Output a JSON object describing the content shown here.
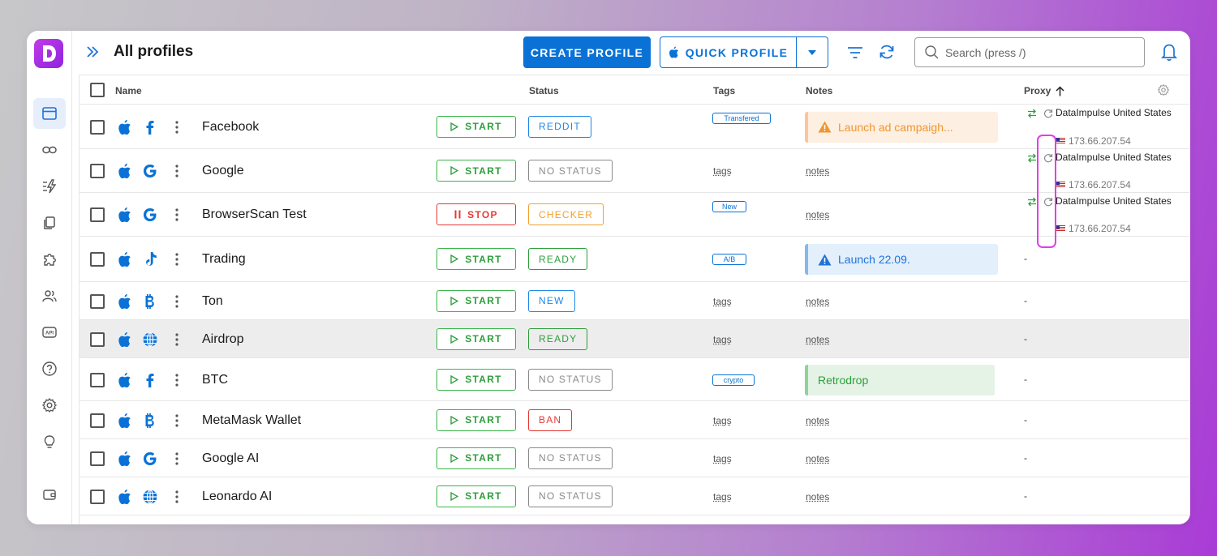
{
  "app": {
    "logo_letter": "D",
    "brand_color": "#a52de2",
    "accent": "#0a72d6"
  },
  "sidebar": {
    "items": [
      {
        "name": "profiles",
        "icon": "browser-window-icon",
        "active": true
      },
      {
        "name": "proxies",
        "icon": "link-icon"
      },
      {
        "name": "automation",
        "icon": "lightning-icon"
      },
      {
        "name": "copies",
        "icon": "copy-icon"
      },
      {
        "name": "extensions",
        "icon": "puzzle-icon"
      },
      {
        "name": "team",
        "icon": "users-icon"
      },
      {
        "name": "api",
        "icon": "api-icon",
        "label": "API"
      },
      {
        "name": "help",
        "icon": "help-icon"
      },
      {
        "name": "settings",
        "icon": "gear-icon"
      },
      {
        "name": "ideas",
        "icon": "lightbulb-icon"
      },
      {
        "name": "wallet",
        "icon": "wallet-icon"
      }
    ]
  },
  "header": {
    "title": "All profiles",
    "create_label": "CREATE PROFILE",
    "quick_label": "QUICK PROFILE",
    "search_placeholder": "Search (press /)"
  },
  "table": {
    "columns": {
      "name": "Name",
      "status": "Status",
      "tags": "Tags",
      "notes": "Notes",
      "proxy": "Proxy"
    },
    "rows": [
      {
        "name": "Facebook",
        "app": "facebook",
        "action": "START",
        "status": "REDDIT",
        "status_color": "#1e88e5",
        "tag": "Transfered",
        "note": "Launch ad campaigh...",
        "note_type": "warning",
        "proxy": {
          "name": "DataImpulse United States",
          "ip": "173.66.207.54"
        }
      },
      {
        "name": "Google",
        "app": "google",
        "action": "START",
        "status": "NO STATUS",
        "status_color": "#8a8a8a",
        "tag_placeholder": "tags",
        "note_placeholder": "notes",
        "proxy": {
          "name": "DataImpulse United States",
          "ip": "173.66.207.54"
        }
      },
      {
        "name": "BrowserScan Test",
        "app": "google",
        "action": "STOP",
        "status": "CHECKER",
        "status_color": "#f0a030",
        "tag": "New",
        "note_placeholder": "notes",
        "proxy": {
          "name": "DataImpulse United States",
          "ip": "173.66.207.54"
        }
      },
      {
        "name": "Trading",
        "app": "tiktok",
        "action": "START",
        "status": "READY",
        "status_color": "#2e9e3c",
        "tag": "A/B",
        "note": "Launch 22.09.",
        "note_type": "info",
        "proxy_dash": "-"
      },
      {
        "name": "Ton",
        "app": "bitcoin",
        "action": "START",
        "status": "NEW",
        "status_color": "#1e88e5",
        "tag_placeholder": "tags",
        "note_placeholder": "notes",
        "proxy_dash": "-"
      },
      {
        "name": "Airdrop",
        "app": "globe",
        "action": "START",
        "status": "READY",
        "status_color": "#2e9e3c",
        "tag_placeholder": "tags",
        "note_placeholder": "notes",
        "proxy_dash": "-"
      },
      {
        "name": "BTC",
        "app": "facebook",
        "action": "START",
        "status": "NO STATUS",
        "status_color": "#8a8a8a",
        "tag": "crypto",
        "note": "Retrodrop",
        "note_type": "success",
        "proxy_dash": "-"
      },
      {
        "name": "MetaMask Wallet",
        "app": "bitcoin",
        "action": "START",
        "status": "BAN",
        "status_color": "#e53935",
        "tag_placeholder": "tags",
        "note_placeholder": "notes",
        "proxy_dash": "-"
      },
      {
        "name": "Google AI",
        "app": "google",
        "action": "START",
        "status": "NO STATUS",
        "status_color": "#8a8a8a",
        "tag_placeholder": "tags",
        "note_placeholder": "notes",
        "proxy_dash": "-"
      },
      {
        "name": "Leonardo AI",
        "app": "globe",
        "action": "START",
        "status": "NO STATUS",
        "status_color": "#8a8a8a",
        "tag_placeholder": "tags",
        "note_placeholder": "notes",
        "proxy_dash": "-"
      }
    ]
  }
}
